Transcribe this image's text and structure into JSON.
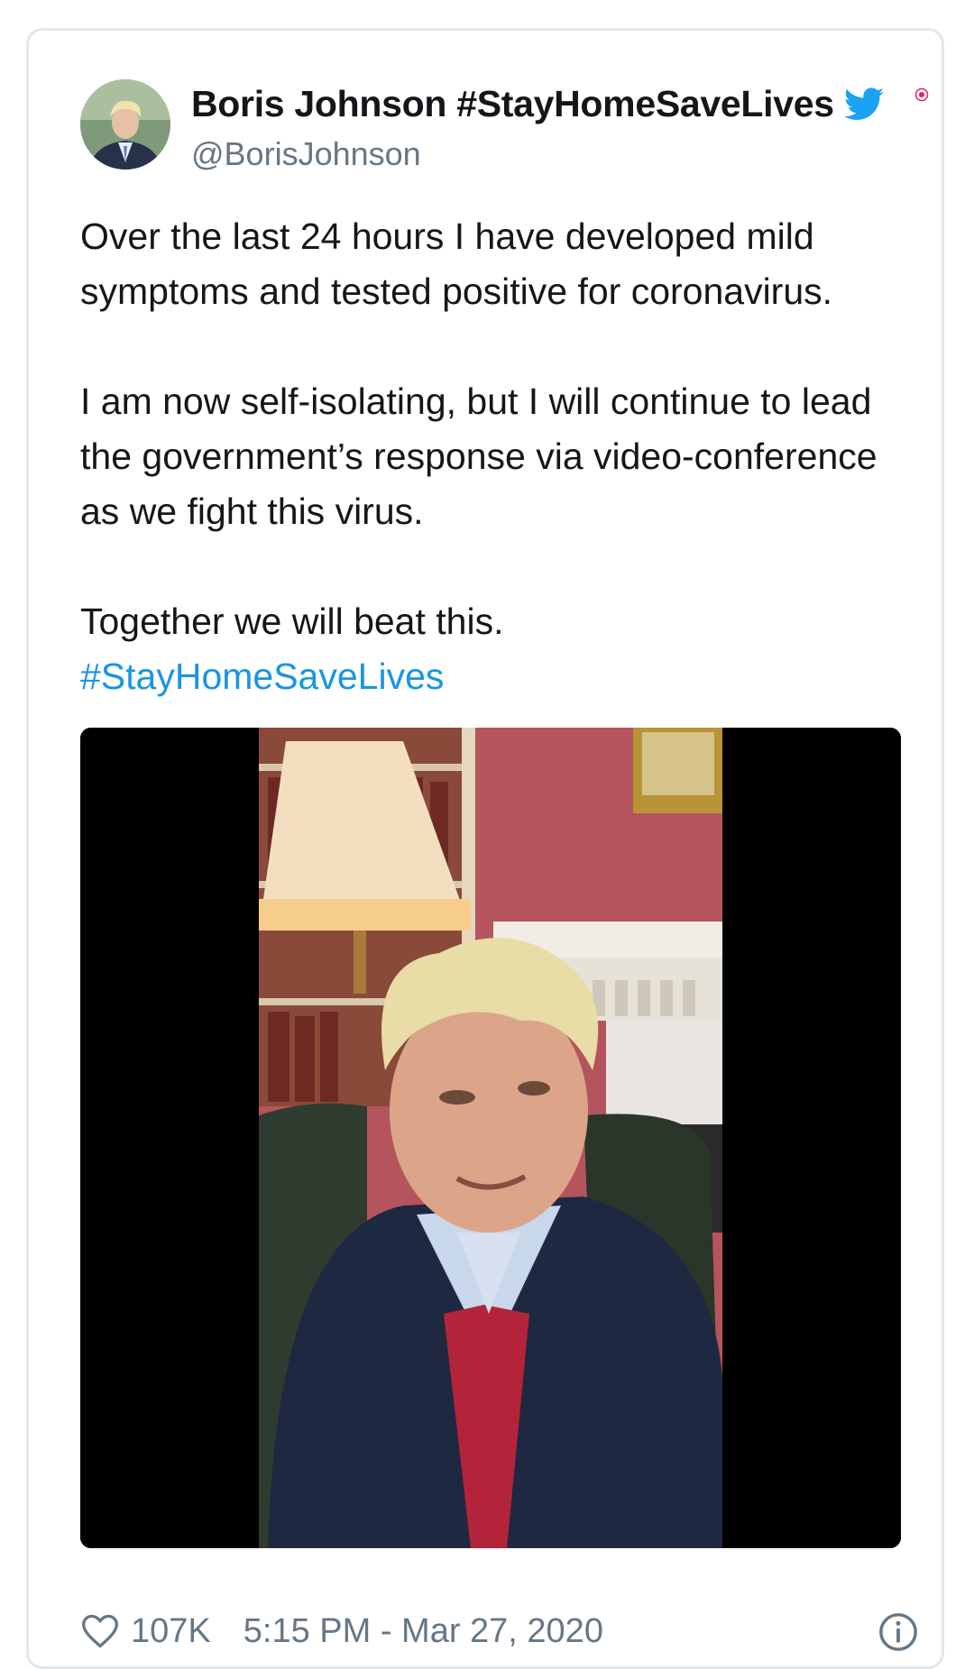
{
  "tweet": {
    "display_name": "Boris Johnson #StayHomeSaveLives",
    "handle": "@BorisJohnson",
    "paragraphs": [
      "Over the last 24 hours I have developed mild symptoms and tested positive for coronavirus.",
      "I am now self-isolating, but I will continue to lead the government’s response via video-conference as we fight this virus.",
      "Together we will beat this."
    ],
    "hashtag": "#StayHomeSaveLives",
    "likes": "107K",
    "timestamp": "5:15 PM - Mar 27, 2020"
  },
  "icons": {
    "hashtag_emoji": "twitter-bird-icon",
    "like": "heart-icon",
    "info": "info-icon"
  },
  "colors": {
    "text": "#14171a",
    "secondary": "#657786",
    "link": "#1b95e0",
    "border": "#e1e8ed",
    "media_bg": "#000000"
  }
}
